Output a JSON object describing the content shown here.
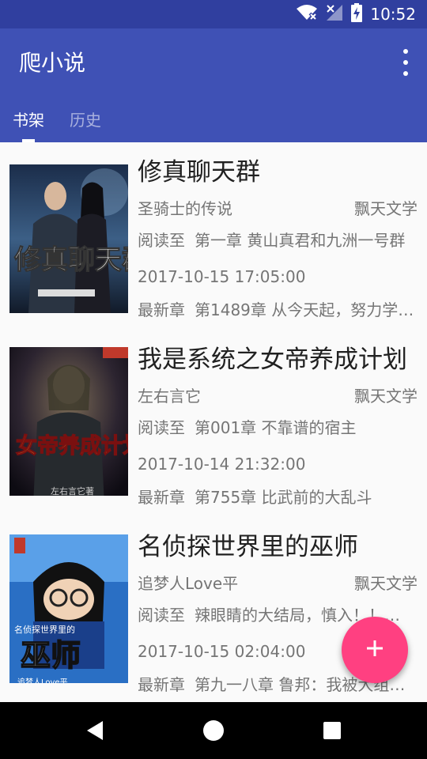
{
  "status_bar": {
    "time": "10:52",
    "icons": [
      "wifi-off-icon",
      "signal-off-icon",
      "battery-charging-icon"
    ]
  },
  "app_bar": {
    "title": "爬小说",
    "menu_icon": "more-vert-icon"
  },
  "tabs": [
    {
      "label": "书架",
      "active": true
    },
    {
      "label": "历史",
      "active": false
    }
  ],
  "books": [
    {
      "title": "修真聊天群",
      "author": "圣骑士的传说",
      "source": "飘天文学",
      "read_label": "阅读至",
      "read_chapter": "第一章 黄山真君和九洲一号群",
      "date": "2017-10-15 17:05:00",
      "latest_label": "最新章",
      "latest_chapter": "第1489章 从今天起，努力学…",
      "cover_text": "修真聊天群"
    },
    {
      "title": "我是系统之女帝养成计划",
      "author": "左右言它",
      "source": "飘天文学",
      "read_label": "阅读至",
      "read_chapter": "第001章 不靠谱的宿主",
      "date": "2017-10-14 21:32:00",
      "latest_label": "最新章",
      "latest_chapter": "第755章 比武前的大乱斗",
      "cover_text": "女帝养成计划"
    },
    {
      "title": "名侦探世界里的巫师",
      "author": "追梦人Love平",
      "source": "飘天文学",
      "read_label": "阅读至",
      "read_chapter": "辣眼睛的大结局，慎入！！…",
      "date": "2017-10-15 02:04:00",
      "latest_label": "最新章",
      "latest_chapter": "第九一八章 鲁邦：我被大组…",
      "cover_text": "巫师"
    }
  ],
  "fab": {
    "icon": "add-icon",
    "color": "#ff4081"
  },
  "nav_bar": {
    "icons": [
      "back-icon",
      "home-icon",
      "recents-icon"
    ]
  },
  "colors": {
    "primary": "#3f51b5",
    "primary_dark": "#303f9f",
    "accent": "#ff4081"
  }
}
